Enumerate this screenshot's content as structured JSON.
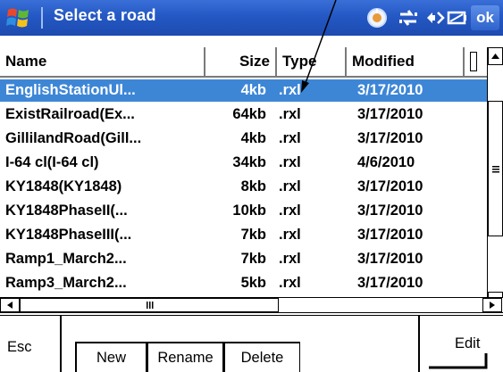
{
  "app": {
    "title": "Select a road",
    "ok_label": "ok"
  },
  "tray_icons": [
    "sync-icon",
    "connectivity-icon",
    "speaker-icon",
    "battery-icon"
  ],
  "list": {
    "columns": [
      "Name",
      "Size",
      "Type",
      "Modified"
    ],
    "rows": [
      {
        "name": "EnglishStationUl...",
        "size": "4kb",
        "type": ".rxl",
        "modified": "3/17/2010",
        "selected": true
      },
      {
        "name": "ExistRailroad(Ex...",
        "size": "64kb",
        "type": ".rxl",
        "modified": "3/17/2010"
      },
      {
        "name": "GillilandRoad(Gill...",
        "size": "4kb",
        "type": ".rxl",
        "modified": "3/17/2010"
      },
      {
        "name": "I-64 cl(I-64 cl)",
        "size": "34kb",
        "type": ".rxl",
        "modified": "4/6/2010"
      },
      {
        "name": "KY1848(KY1848)",
        "size": "8kb",
        "type": ".rxl",
        "modified": "3/17/2010"
      },
      {
        "name": "KY1848PhaseII(...",
        "size": "10kb",
        "type": ".rxl",
        "modified": "3/17/2010"
      },
      {
        "name": "KY1848PhaseIII(...",
        "size": "7kb",
        "type": ".rxl",
        "modified": "3/17/2010"
      },
      {
        "name": "Ramp1_March2...",
        "size": "7kb",
        "type": ".rxl",
        "modified": "3/17/2010"
      },
      {
        "name": "Ramp3_March2...",
        "size": "5kb",
        "type": ".rxl",
        "modified": "3/17/2010"
      }
    ]
  },
  "softkeys": {
    "left": "Esc",
    "right": "Edit"
  },
  "buttons": {
    "new": "New",
    "rename": "Rename",
    "delete": "Delete"
  },
  "colors": {
    "titlebar": "#2458c4",
    "selection": "#3d86d6"
  }
}
